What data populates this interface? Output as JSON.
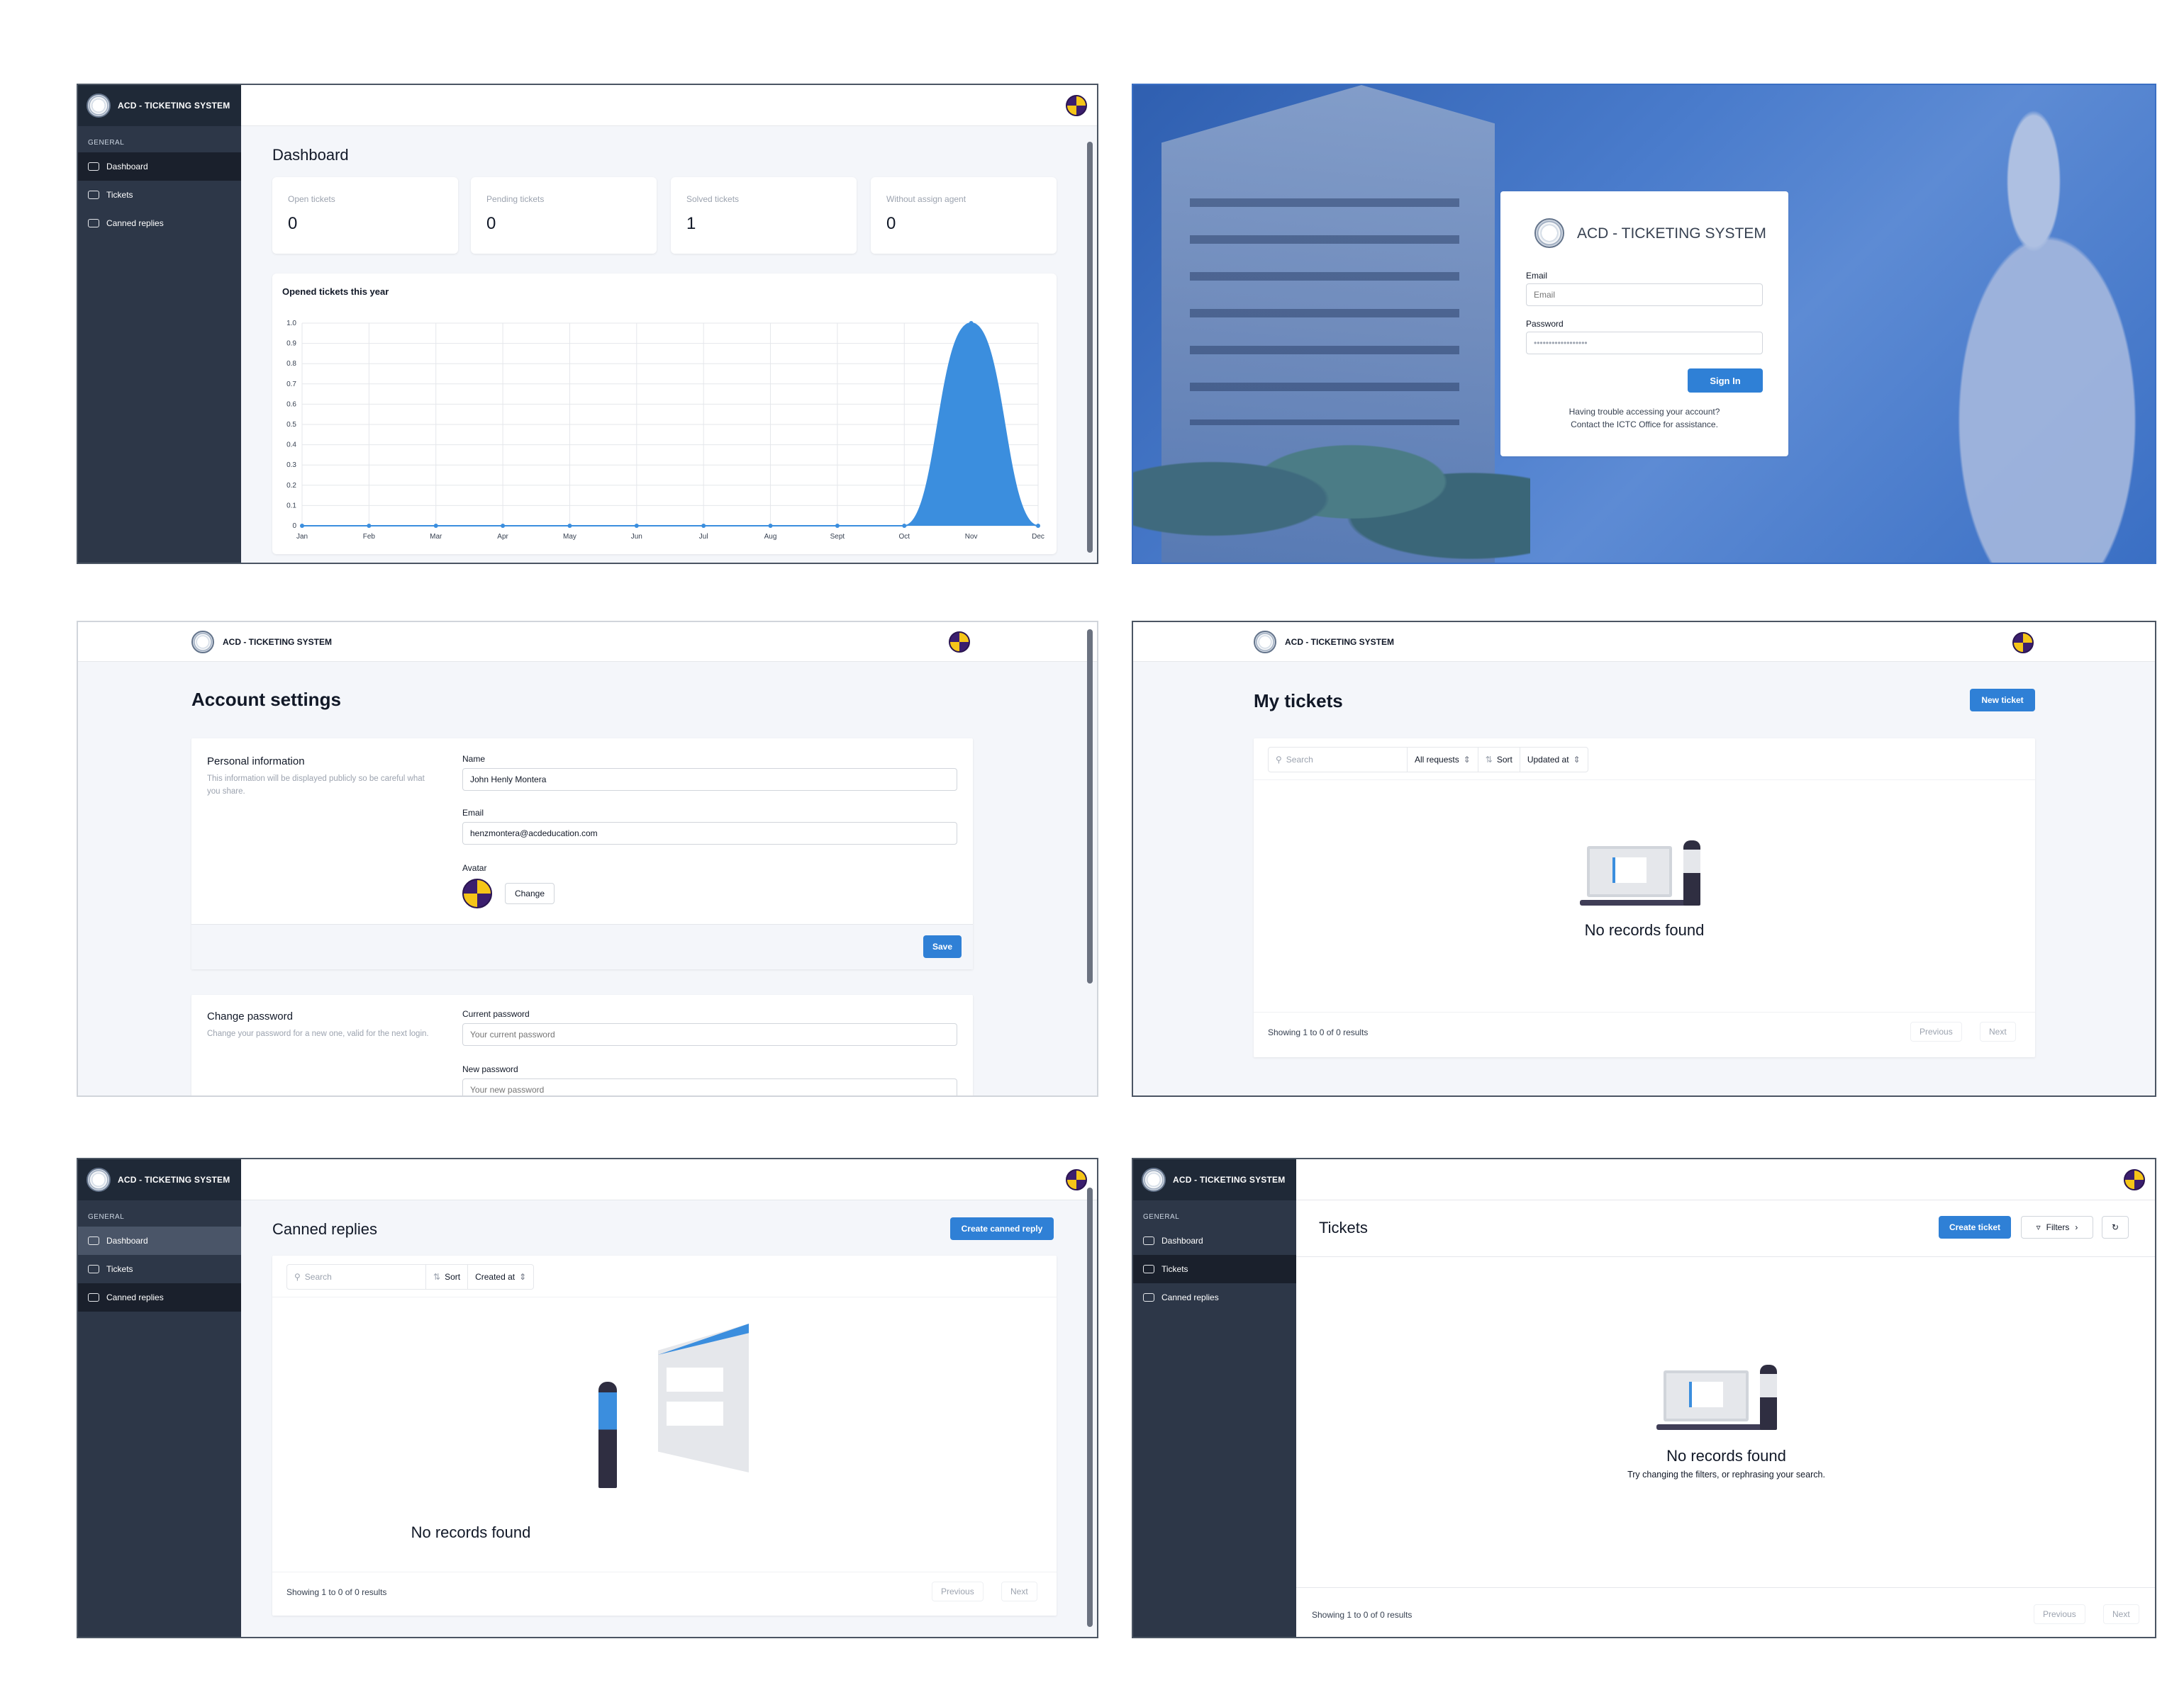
{
  "app_name": "ACD - TICKETING SYSTEM",
  "sidebar": {
    "section": "GENERAL",
    "items": [
      {
        "label": "Dashboard",
        "icon": "dashboard-icon"
      },
      {
        "label": "Tickets",
        "icon": "inbox-icon"
      },
      {
        "label": "Canned replies",
        "icon": "chat-icon"
      }
    ]
  },
  "dashboard": {
    "title": "Dashboard",
    "stats": [
      {
        "label": "Open tickets",
        "value": "0"
      },
      {
        "label": "Pending tickets",
        "value": "0"
      },
      {
        "label": "Solved tickets",
        "value": "1"
      },
      {
        "label": "Without assign agent",
        "value": "0"
      }
    ],
    "chart_title": "Opened tickets this year"
  },
  "chart_data": {
    "type": "area",
    "title": "Opened tickets this year",
    "categories": [
      "Jan",
      "Feb",
      "Mar",
      "Apr",
      "May",
      "Jun",
      "Jul",
      "Aug",
      "Sept",
      "Oct",
      "Nov",
      "Dec"
    ],
    "values": [
      0,
      0,
      0,
      0,
      0,
      0,
      0,
      0,
      0,
      0,
      1,
      0
    ],
    "y_ticks": [
      "0",
      "0.1",
      "0.2",
      "0.3",
      "0.4",
      "0.5",
      "0.6",
      "0.7",
      "0.8",
      "0.9",
      "1.0"
    ],
    "ylim": [
      0,
      1
    ],
    "grid": true,
    "color": "#3b8ede"
  },
  "login": {
    "title": "ACD - TICKETING SYSTEM",
    "email_label": "Email",
    "email_placeholder": "Email",
    "password_label": "Password",
    "password_value": "••••••••••••••••••",
    "sign_in": "Sign In",
    "help_line1": "Having trouble accessing your account?",
    "help_line2": "Contact the ICTC Office for assistance."
  },
  "account": {
    "title": "Account settings",
    "personal_title": "Personal information",
    "personal_desc": "This information will be displayed publicly so be careful what you share.",
    "name_label": "Name",
    "name_value": "John Henly Montera",
    "email_label": "Email",
    "email_value": "henzmontera@acdeducation.com",
    "avatar_label": "Avatar",
    "change_button": "Change",
    "save_button": "Save",
    "password_title": "Change password",
    "password_desc": "Change your password for a new one, valid for the next login.",
    "current_label": "Current password",
    "current_placeholder": "Your current password",
    "new_label": "New password",
    "new_placeholder": "Your new password"
  },
  "my_tickets": {
    "title": "My tickets",
    "new_button": "New ticket",
    "search_placeholder": "Search",
    "filter": "All requests",
    "sort": "Sort",
    "sort_field": "Updated at",
    "empty": "No records found",
    "showing": "Showing 1 to 0 of 0 results",
    "previous": "Previous",
    "next": "Next"
  },
  "canned": {
    "title": "Canned replies",
    "create_button": "Create canned reply",
    "search_placeholder": "Search",
    "sort": "Sort",
    "sort_field": "Created at",
    "empty": "No records found",
    "showing": "Showing 1 to 0 of 0 results",
    "previous": "Previous",
    "next": "Next"
  },
  "tickets": {
    "title": "Tickets",
    "create_button": "Create ticket",
    "filters_button": "Filters",
    "empty": "No records found",
    "empty_sub": "Try changing the filters, or rephrasing your search.",
    "showing": "Showing 1 to 0 of 0 results",
    "previous": "Previous",
    "next": "Next"
  },
  "colors": {
    "accent": "#2f80d6",
    "sidebar": "#2d3748",
    "login_overlay": "#3a6fc4"
  }
}
